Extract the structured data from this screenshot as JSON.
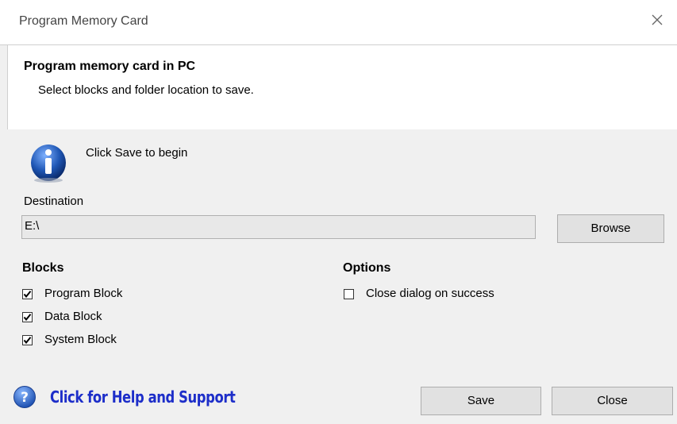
{
  "window": {
    "title": "Program Memory Card"
  },
  "header": {
    "title": "Program memory card in PC",
    "subtitle": "Select blocks and folder location to save."
  },
  "info": {
    "icon": "info-icon",
    "message": "Click Save to begin"
  },
  "destination": {
    "label": "Destination",
    "value": "E:\\",
    "browse_label": "Browse"
  },
  "blocks": {
    "label": "Blocks",
    "items": [
      {
        "label": "Program Block",
        "checked": true
      },
      {
        "label": "Data Block",
        "checked": true
      },
      {
        "label": "System Block",
        "checked": true
      }
    ]
  },
  "options": {
    "label": "Options",
    "items": [
      {
        "label": "Close dialog on success",
        "checked": false
      }
    ]
  },
  "footer": {
    "help_link": "Click for Help and Support",
    "save_label": "Save",
    "close_label": "Close"
  },
  "colors": {
    "help_link": "#1d2ec9",
    "info_icon": "#1f57b5",
    "help_icon": "#2f6fd1"
  }
}
